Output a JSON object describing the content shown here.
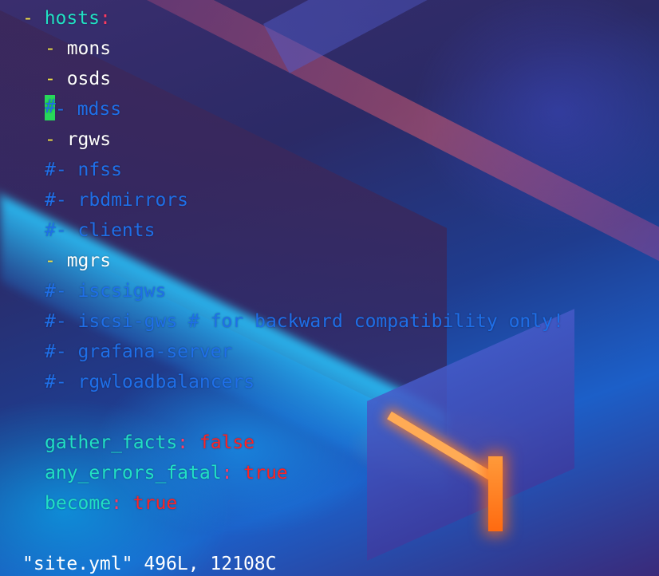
{
  "editor": {
    "hosts": {
      "dash": "- ",
      "key": "hosts",
      "colon": ":"
    },
    "items": [
      {
        "kind": "active",
        "dash": "- ",
        "name": "mons"
      },
      {
        "kind": "active",
        "dash": "- ",
        "name": "osds"
      },
      {
        "kind": "cursor_comment",
        "cursor_char": "#",
        "text": "- mdss"
      },
      {
        "kind": "active",
        "dash": "- ",
        "name": "rgws"
      },
      {
        "kind": "comment",
        "text": "#- nfss"
      },
      {
        "kind": "comment",
        "text": "#- rbdmirrors"
      },
      {
        "kind": "comment",
        "text": "#- clients"
      },
      {
        "kind": "active",
        "dash": "- ",
        "name": "mgrs"
      },
      {
        "kind": "comment",
        "text": "#- iscsigws"
      },
      {
        "kind": "comment",
        "text": "#- iscsi-gws # for backward compatibility only!"
      },
      {
        "kind": "comment",
        "text": "#- grafana-server"
      },
      {
        "kind": "comment",
        "text": "#- rgwloadbalancers"
      }
    ],
    "settings": [
      {
        "key": "gather_facts",
        "colon": ":",
        "value": " false"
      },
      {
        "key": "any_errors_fatal",
        "colon": ":",
        "value": " true"
      },
      {
        "key": "become",
        "colon": ":",
        "value": " true"
      }
    ],
    "status_line": "\"site.yml\" 496L, 12108C"
  },
  "colors": {
    "dash": "#f2e24a",
    "key": "#21e0c4",
    "colon": "#ff3b63",
    "comment": "#1f6fe8",
    "boolean": "#ff2222",
    "cursor": "#27d85a",
    "text": "#ffffff"
  }
}
